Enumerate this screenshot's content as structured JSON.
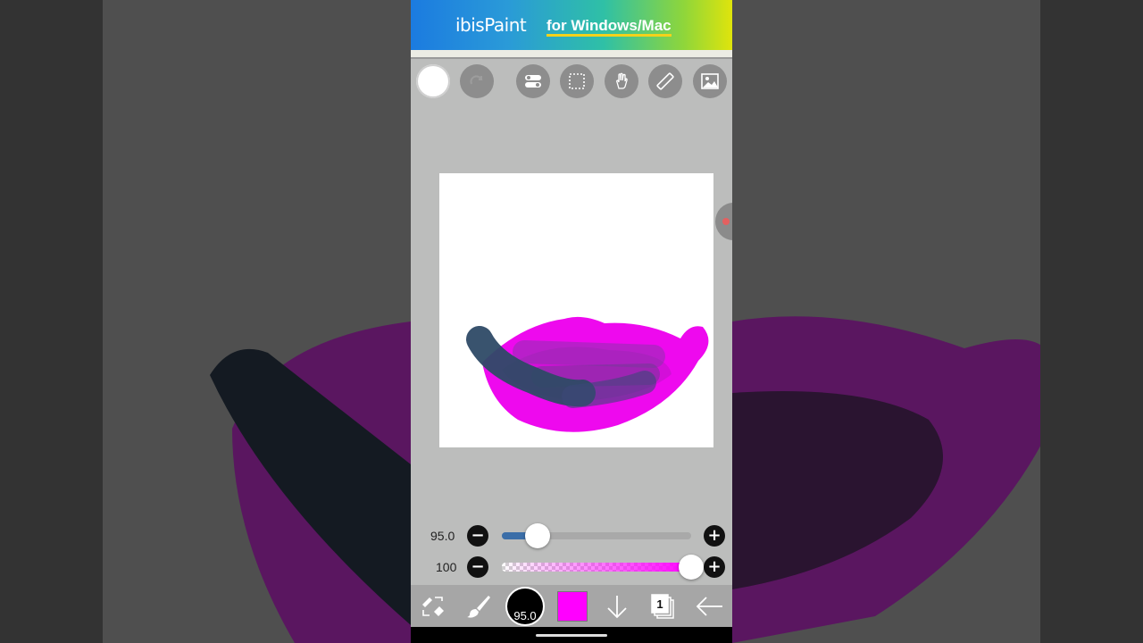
{
  "banner": {
    "brand": "ibisPaint",
    "tagline": "for Windows/Mac"
  },
  "toolbar": {
    "items": [
      {
        "name": "brush-preview-icon"
      },
      {
        "name": "redo-icon"
      },
      {
        "name": "toggle-settings-icon"
      },
      {
        "name": "selection-icon"
      },
      {
        "name": "hand-tool-icon"
      },
      {
        "name": "ruler-icon"
      },
      {
        "name": "image-icon"
      }
    ]
  },
  "sliders": {
    "size": {
      "label": "95.0",
      "value": 95.0,
      "fill_fraction": 0.19
    },
    "opacity": {
      "label": "100",
      "value": 100,
      "fill_fraction": 1.0
    }
  },
  "bottom_bar": {
    "brush_size_label": "95.0",
    "layer_count": "1",
    "current_color": "#ff00ff"
  },
  "colors": {
    "accent_blue": "#3b6ea8",
    "magenta": "#ff00ff",
    "canvas_bg": "#ffffff",
    "workspace_bg": "#bcbdbc"
  }
}
